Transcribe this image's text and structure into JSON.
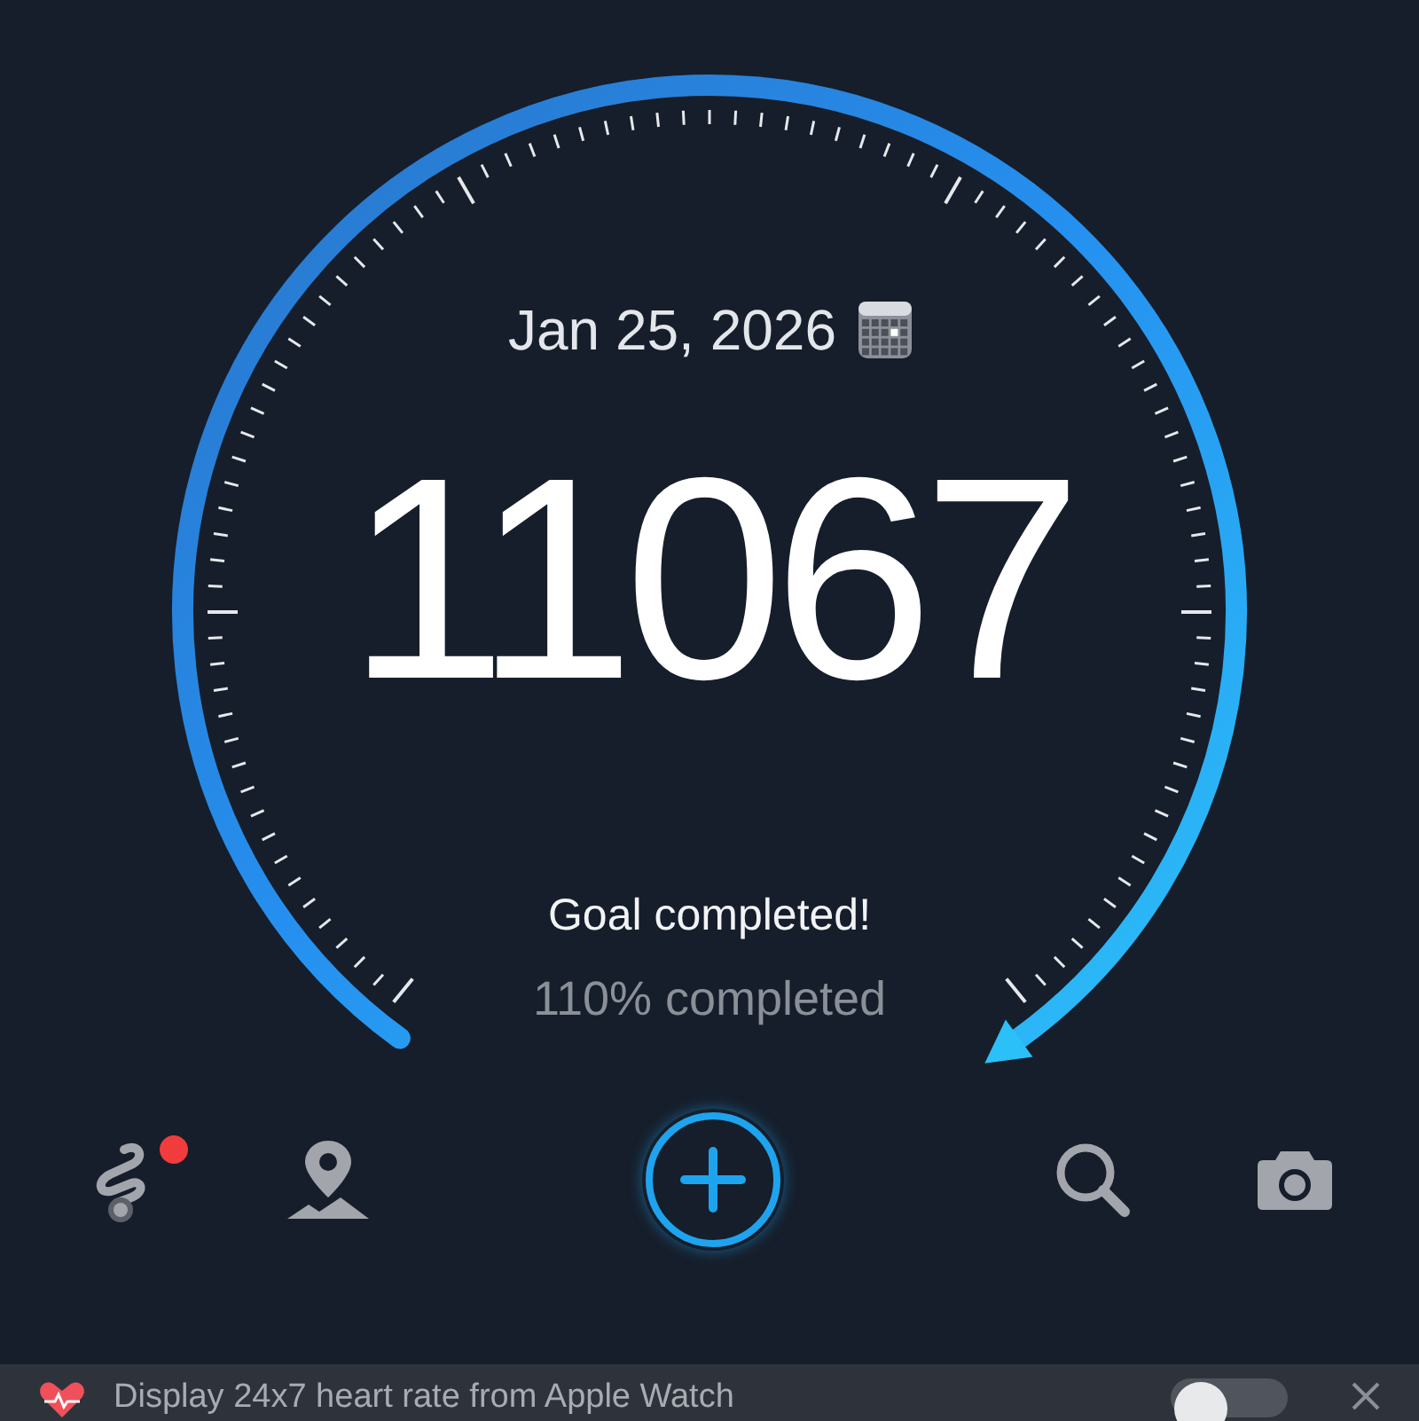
{
  "date": "Jan 25, 2026",
  "steps": "11067",
  "goal_message": "Goal completed!",
  "progress_text": "110% completed",
  "toolbar": [
    {
      "kind": "route",
      "badge": true
    },
    {
      "kind": "map",
      "badge": false
    },
    {
      "kind": "add",
      "badge": false
    },
    {
      "kind": "search",
      "badge": false
    },
    {
      "kind": "camera",
      "badge": false
    }
  ],
  "banner": {
    "text": "Display 24x7 heart rate from Apple Watch",
    "on": false
  }
}
